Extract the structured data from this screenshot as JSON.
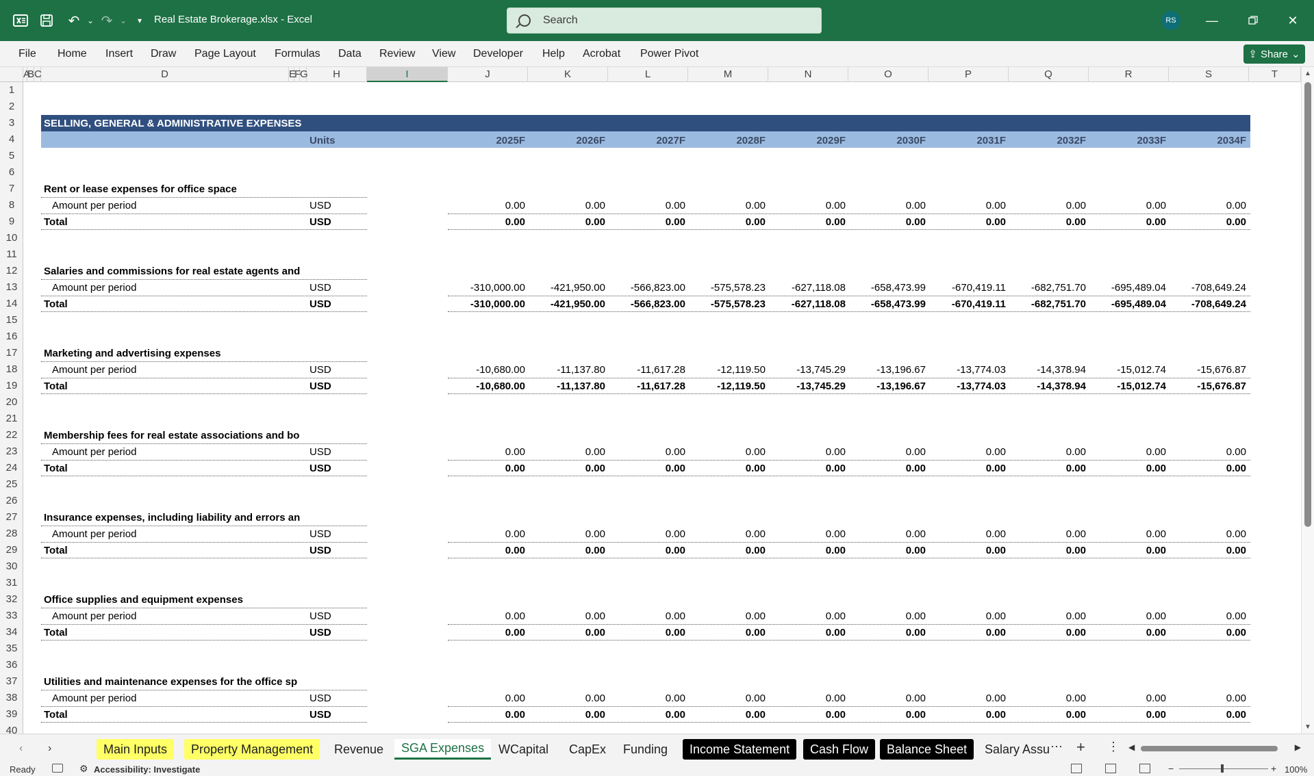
{
  "titlebar": {
    "doc_title": "Real Estate Brokerage.xlsx  -  Excel",
    "search_placeholder": "Search",
    "avatar_initials": "RS"
  },
  "menu": [
    "File",
    "Home",
    "Insert",
    "Draw",
    "Page Layout",
    "Formulas",
    "Data",
    "Review",
    "View",
    "Developer",
    "Help",
    "Acrobat",
    "Power Pivot"
  ],
  "share_label": "Share",
  "columns": [
    "A",
    "B",
    "C",
    "D",
    "E",
    "F",
    "G",
    "H",
    "I",
    "J",
    "K",
    "L",
    "M",
    "N",
    "O",
    "P",
    "Q",
    "R",
    "S",
    "T"
  ],
  "selected_column": "I",
  "rows": [
    "1",
    "2",
    "3",
    "4",
    "5",
    "6",
    "7",
    "8",
    "9",
    "10",
    "11",
    "12",
    "13",
    "14",
    "15",
    "16",
    "17",
    "18",
    "19",
    "20",
    "21",
    "22",
    "23",
    "24",
    "25",
    "26",
    "27",
    "28",
    "29",
    "30",
    "31",
    "32",
    "33",
    "34",
    "35",
    "36",
    "37",
    "38",
    "39",
    "40"
  ],
  "sheet": {
    "section_title": "SELLING, GENERAL & ADMINISTRATIVE EXPENSES",
    "units_header": "Units",
    "years": [
      "2025F",
      "2026F",
      "2027F",
      "2028F",
      "2029F",
      "2030F",
      "2031F",
      "2032F",
      "2033F",
      "2034F"
    ],
    "amount_label": "Amount per period",
    "total_label": "Total",
    "unit": "USD",
    "blocks": [
      {
        "title": "Rent or lease expenses for office space",
        "amounts": [
          "0.00",
          "0.00",
          "0.00",
          "0.00",
          "0.00",
          "0.00",
          "0.00",
          "0.00",
          "0.00",
          "0.00"
        ],
        "totals": [
          "0.00",
          "0.00",
          "0.00",
          "0.00",
          "0.00",
          "0.00",
          "0.00",
          "0.00",
          "0.00",
          "0.00"
        ]
      },
      {
        "title": "Salaries and commissions for real estate agents and",
        "amounts": [
          "-310,000.00",
          "-421,950.00",
          "-566,823.00",
          "-575,578.23",
          "-627,118.08",
          "-658,473.99",
          "-670,419.11",
          "-682,751.70",
          "-695,489.04",
          "-708,649.24"
        ],
        "totals": [
          "-310,000.00",
          "-421,950.00",
          "-566,823.00",
          "-575,578.23",
          "-627,118.08",
          "-658,473.99",
          "-670,419.11",
          "-682,751.70",
          "-695,489.04",
          "-708,649.24"
        ]
      },
      {
        "title": "Marketing and advertising expenses",
        "amounts": [
          "-10,680.00",
          "-11,137.80",
          "-11,617.28",
          "-12,119.50",
          "-13,745.29",
          "-13,196.67",
          "-13,774.03",
          "-14,378.94",
          "-15,012.74",
          "-15,676.87"
        ],
        "totals": [
          "-10,680.00",
          "-11,137.80",
          "-11,617.28",
          "-12,119.50",
          "-13,745.29",
          "-13,196.67",
          "-13,774.03",
          "-14,378.94",
          "-15,012.74",
          "-15,676.87"
        ]
      },
      {
        "title": "Membership fees for real estate associations and bo",
        "amounts": [
          "0.00",
          "0.00",
          "0.00",
          "0.00",
          "0.00",
          "0.00",
          "0.00",
          "0.00",
          "0.00",
          "0.00"
        ],
        "totals": [
          "0.00",
          "0.00",
          "0.00",
          "0.00",
          "0.00",
          "0.00",
          "0.00",
          "0.00",
          "0.00",
          "0.00"
        ]
      },
      {
        "title": "Insurance expenses, including liability and errors an",
        "amounts": [
          "0.00",
          "0.00",
          "0.00",
          "0.00",
          "0.00",
          "0.00",
          "0.00",
          "0.00",
          "0.00",
          "0.00"
        ],
        "totals": [
          "0.00",
          "0.00",
          "0.00",
          "0.00",
          "0.00",
          "0.00",
          "0.00",
          "0.00",
          "0.00",
          "0.00"
        ]
      },
      {
        "title": "Office supplies and equipment expenses",
        "amounts": [
          "0.00",
          "0.00",
          "0.00",
          "0.00",
          "0.00",
          "0.00",
          "0.00",
          "0.00",
          "0.00",
          "0.00"
        ],
        "totals": [
          "0.00",
          "0.00",
          "0.00",
          "0.00",
          "0.00",
          "0.00",
          "0.00",
          "0.00",
          "0.00",
          "0.00"
        ]
      },
      {
        "title": "Utilities and maintenance expenses for the office sp",
        "amounts": [
          "0.00",
          "0.00",
          "0.00",
          "0.00",
          "0.00",
          "0.00",
          "0.00",
          "0.00",
          "0.00",
          "0.00"
        ],
        "totals": [
          "0.00",
          "0.00",
          "0.00",
          "0.00",
          "0.00",
          "0.00",
          "0.00",
          "0.00",
          "0.00",
          "0.00"
        ]
      }
    ]
  },
  "tabs": [
    {
      "label": "Main Inputs",
      "style": "yellow"
    },
    {
      "label": "Property Management",
      "style": "yellow"
    },
    {
      "label": "Revenue",
      "style": "plain"
    },
    {
      "label": "SGA Expenses",
      "style": "active"
    },
    {
      "label": "WCapital",
      "style": "plain"
    },
    {
      "label": "CapEx",
      "style": "plain"
    },
    {
      "label": "Funding",
      "style": "plain"
    },
    {
      "label": "Income Statement",
      "style": "dark"
    },
    {
      "label": "Cash Flow",
      "style": "dark"
    },
    {
      "label": "Balance Sheet",
      "style": "dark"
    },
    {
      "label": "Salary Assu",
      "style": "plain"
    }
  ],
  "status": {
    "ready": "Ready",
    "accessibility": "Accessibility: Investigate",
    "zoom": "100%"
  },
  "colors": {
    "titlebar": "#1e7145",
    "section_band": "#2f4f7f",
    "header_band": "#9bbae0",
    "tab_yellow": "#ffff66",
    "tab_dark": "#000000"
  }
}
